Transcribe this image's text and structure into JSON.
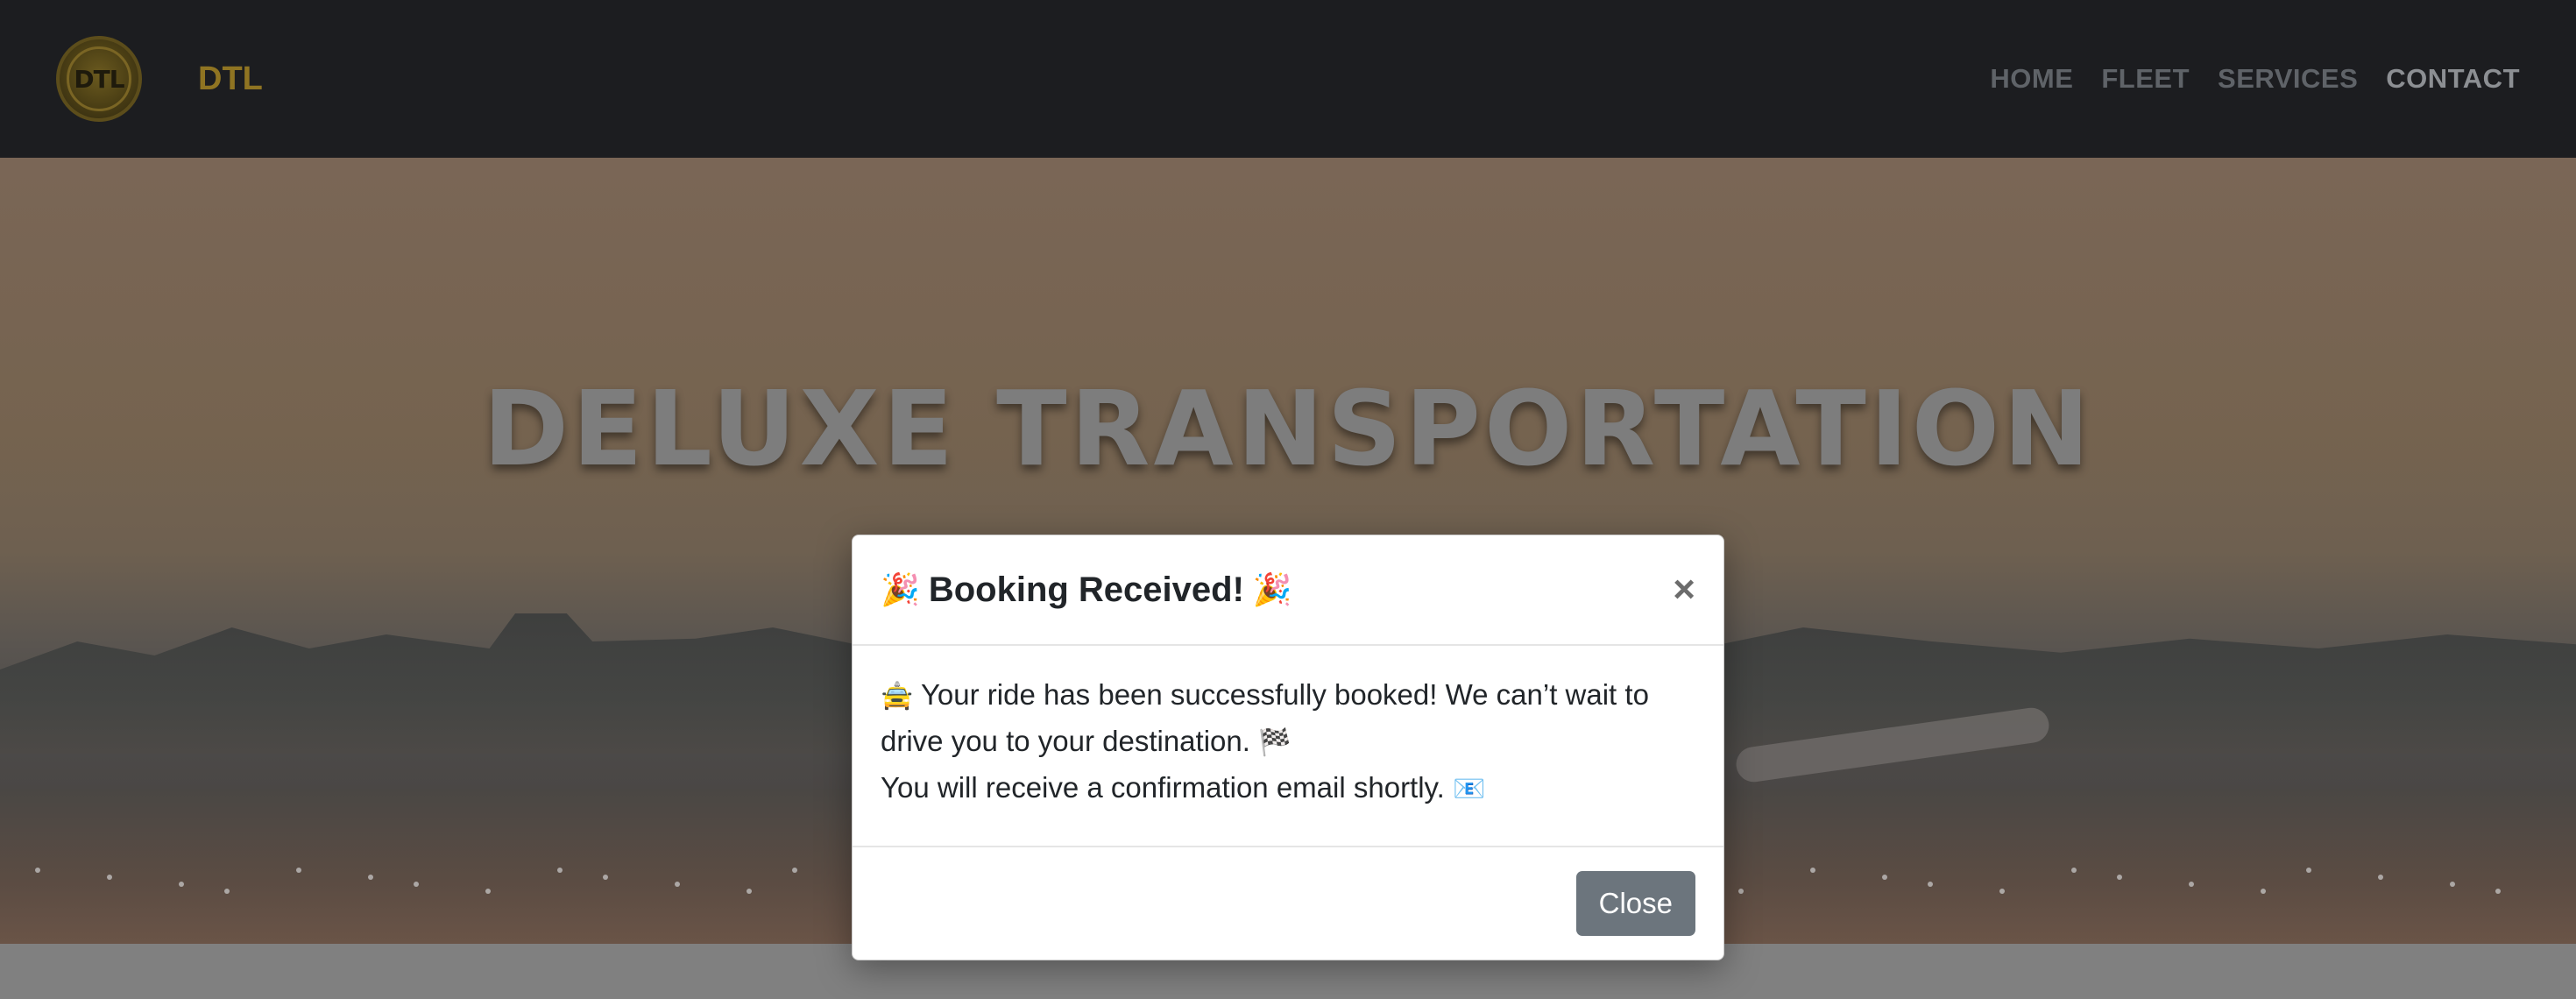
{
  "navbar": {
    "brand": "DTL",
    "logo_text": "DTL",
    "links": [
      "HOME",
      "FLEET",
      "SERVICES",
      "CONTACT"
    ],
    "active": "CONTACT"
  },
  "hero": {
    "title": "DELUXE TRANSPORTATION"
  },
  "modal": {
    "title": "Booking Received!",
    "title_emoji_left": "🎉",
    "title_emoji_right": "🎉",
    "close_symbol": "×",
    "line1_emoji": "🚖",
    "line1": "Your ride has been successfully booked! We can’t wait to drive you to your destination.",
    "line1_end_emoji": "🏁",
    "line2": "You will receive a confirmation email shortly.",
    "line2_emoji": "📧",
    "button_label": "Close"
  },
  "colors": {
    "navbar_bg": "#1c1d20",
    "brand_gold": "#8f7422",
    "button_gray": "#6c757d"
  }
}
